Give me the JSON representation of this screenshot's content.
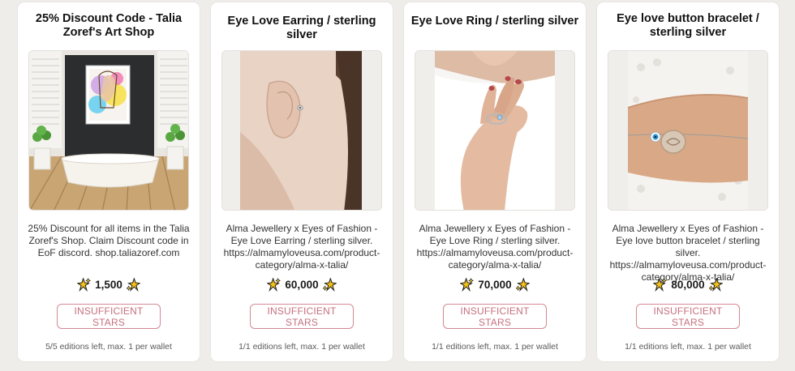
{
  "cards": [
    {
      "title": "25% Discount Code - Talia Zoref's Art Shop",
      "image_alt": "bathroom-with-artwork-image",
      "description": "25% Discount for all items in the Talia Zoref's Shop. Claim Discount code in EoF discord. shop.taliazoref.com",
      "price": "1,500",
      "button": "INSUFFICIENT STARS",
      "editions": "5/5 editions left, max. 1 per wallet"
    },
    {
      "title": "Eye Love Earring / sterling silver",
      "image_alt": "earring-photo",
      "description": "Alma Jewellery x Eyes of Fashion - Eye Love Earring / sterling silver. https://almamyloveusa.com/product-category/alma-x-talia/",
      "price": "60,000",
      "button": "INSUFFICIENT STARS",
      "editions": "1/1 editions left, max. 1 per wallet"
    },
    {
      "title": "Eye Love Ring / sterling silver",
      "image_alt": "ring-photo",
      "description": "Alma Jewellery x Eyes of Fashion - Eye Love Ring / sterling silver. https://almamyloveusa.com/product-category/alma-x-talia/",
      "price": "70,000",
      "button": "INSUFFICIENT STARS",
      "editions": "1/1 editions left, max. 1 per wallet"
    },
    {
      "title": "Eye love button bracelet / sterling silver",
      "image_alt": "bracelet-photo",
      "description": "Alma Jewellery x Eyes of Fashion - Eye love button bracelet / sterling silver. https://almamyloveusa.com/product-category/alma-x-talia/",
      "price": "80,000",
      "button": "INSUFFICIENT STARS",
      "editions": "1/1 editions left, max. 1 per wallet"
    }
  ],
  "colors": {
    "page_bg": "#efedea",
    "button_border": "#d48894",
    "button_text": "#c6707e",
    "star": "#f4c21a"
  },
  "icons": {
    "price_icon": "sparkle-star-icon"
  }
}
